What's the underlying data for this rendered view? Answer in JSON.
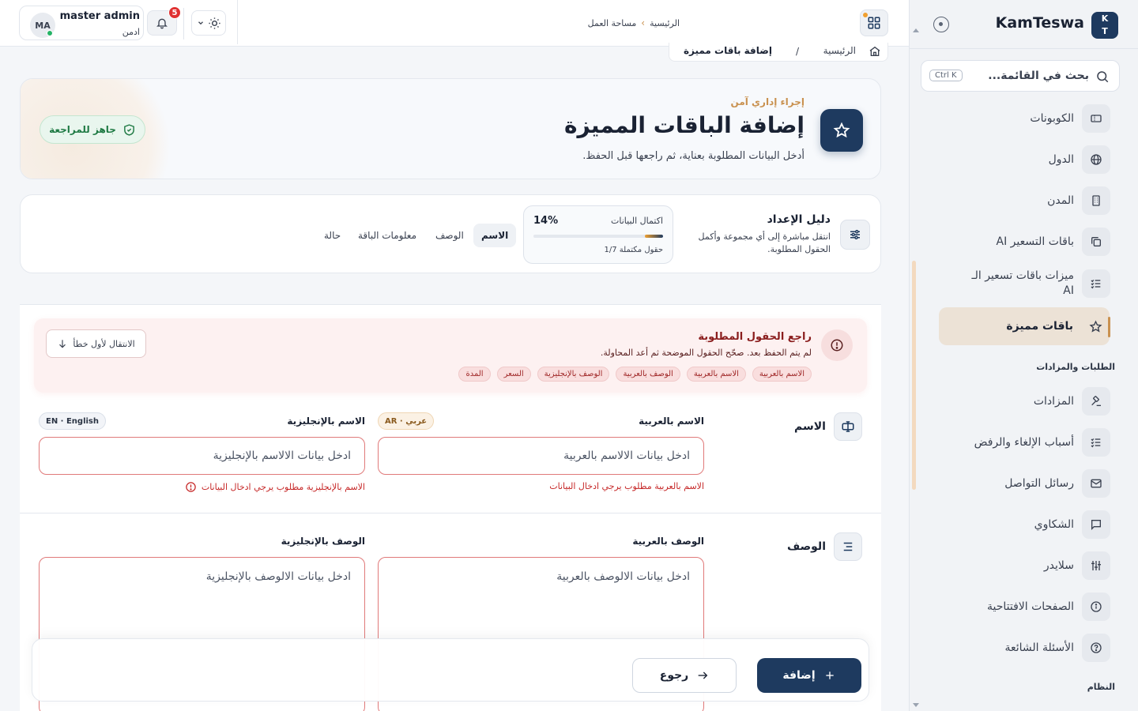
{
  "brand": {
    "name": "KamTeswa",
    "logo_line1": "K",
    "logo_line2": "T"
  },
  "sidebar": {
    "search": {
      "placeholder": "بحث في القائمة...",
      "shortcut": "Ctrl K"
    },
    "items": [
      {
        "label": "الكوبونات",
        "icon": "coupon-icon"
      },
      {
        "label": "الدول",
        "icon": "globe-icon"
      },
      {
        "label": "المدن",
        "icon": "building-icon"
      },
      {
        "label": "باقات التسعير AI",
        "icon": "copy-icon"
      },
      {
        "label": "ميزات باقات تسعير الـ AI",
        "icon": "list-check-icon"
      },
      {
        "label": "باقات مميزة",
        "icon": "star-icon",
        "active": true
      },
      {
        "label": "المزادات",
        "icon": "gavel-icon"
      },
      {
        "label": "أسباب الإلغاء والرفض",
        "icon": "list-check-icon"
      },
      {
        "label": "رسائل التواصل",
        "icon": "mail-icon"
      },
      {
        "label": "الشكاوي",
        "icon": "message-icon"
      },
      {
        "label": "سلايدر",
        "icon": "sliders-icon"
      },
      {
        "label": "الصفحات الافتتاحية",
        "icon": "info-icon"
      },
      {
        "label": "الأسئلة الشائعة",
        "icon": "help-icon"
      }
    ],
    "sections": {
      "orders": "الطلبات والمزادات",
      "system": "النظام"
    }
  },
  "topbar": {
    "user": {
      "initials": "MA",
      "name": "master admin",
      "role": "ادمن"
    },
    "notifications_count": "5",
    "breadcrumb": {
      "home": "الرئيسية",
      "current": "مساحة العمل"
    }
  },
  "page": {
    "breadcrumb": {
      "home": "الرئيسية",
      "separator": "/",
      "current": "إضافة باقات مميزة"
    },
    "hero": {
      "kicker": "إجراء إداري آمن",
      "title": "إضافة الباقات المميزة",
      "subtitle": "أدخل البيانات المطلوبة بعناية، ثم راجعها قبل الحفظ.",
      "ready_label": "جاهز للمراجعة"
    },
    "guide": {
      "title": "دليل الإعداد",
      "subtitle": "انتقل مباشرة إلى أي مجموعة وأكمل الحقول المطلوبة.",
      "progress_label": "اكتمال البيانات",
      "progress_percent": "14%",
      "progress_value": 0.14,
      "progress_count": "1/7 حقول مكتملة",
      "tabs": [
        "الاسم",
        "الوصف",
        "معلومات الباقة",
        "حالة"
      ]
    },
    "alert": {
      "title": "راجع الحقول المطلوبة",
      "subtitle": "لم يتم الحفظ بعد. صحّح الحقول الموضحة ثم أعد المحاولة.",
      "chips": [
        "الاسم بالعربية",
        "الاسم بالعربية",
        "الوصف بالعربية",
        "الوصف بالإنجليزية",
        "السعر",
        "المدة"
      ],
      "jump_label": "الانتقال لأول خطأ"
    },
    "name_section": {
      "label": "الاسم",
      "ar_label": "الاسم بالعربية",
      "ar_tag": "AR · عربي",
      "ar_placeholder": "ادخل بيانات الالاسم بالعربية",
      "ar_error": "الاسم بالعربية مطلوب يرجي ادخال البيانات",
      "en_label": "الاسم بالإنجليزية",
      "en_tag": "EN · English",
      "en_placeholder": "ادخل بيانات الالاسم بالإنجليزية",
      "en_error": "الاسم بالإنجليزية مطلوب يرجي ادخال البيانات"
    },
    "desc_section": {
      "label": "الوصف",
      "ar_label": "الوصف بالعربية",
      "ar_placeholder": "ادخل بيانات الالوصف بالعربية",
      "en_label": "الوصف بالإنجليزية",
      "en_placeholder": "ادخل بيانات الالوصف بالإنجليزية"
    },
    "actions": {
      "add": "إضافة",
      "back": "رجوع"
    }
  },
  "colors": {
    "primary": "#1e3a5f",
    "accent": "#c9914f",
    "error": "#c62828",
    "success": "#1f7a44"
  }
}
